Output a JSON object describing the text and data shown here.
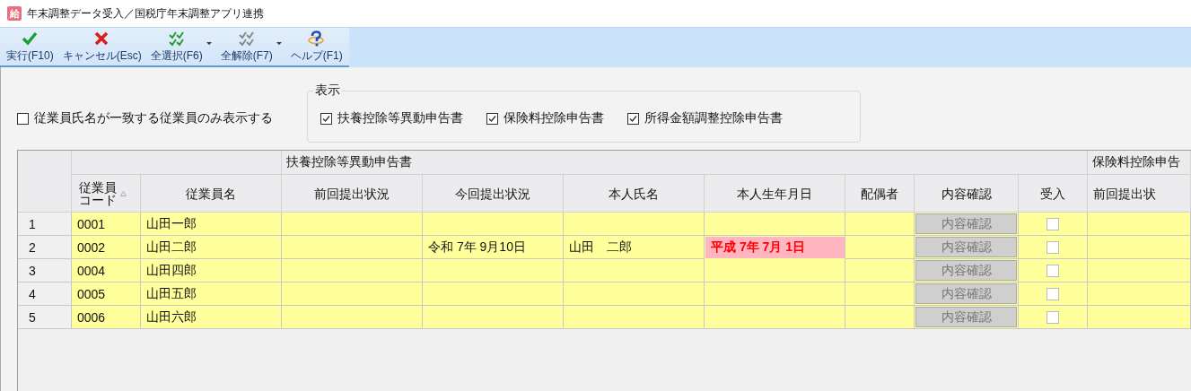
{
  "window": {
    "title": "年末調整データ受入／国税庁年末調整アプリ連携",
    "badge": "給"
  },
  "toolbar": [
    {
      "kind": "execute",
      "label": "実行(F10)",
      "dropdown": false
    },
    {
      "kind": "cancel",
      "label": "キャンセル(Esc)",
      "dropdown": false
    },
    {
      "kind": "select_all",
      "label": "全選択(F6)",
      "dropdown": true
    },
    {
      "kind": "deselect_all",
      "label": "全解除(F7)",
      "dropdown": true
    },
    {
      "kind": "help",
      "label": "ヘルプ(F1)",
      "dropdown": false
    }
  ],
  "filter": {
    "label": "従業員氏名が一致する従業員のみ表示する",
    "checked": false
  },
  "display": {
    "title": "表示",
    "options": [
      {
        "label": "扶養控除等異動申告書",
        "checked": true
      },
      {
        "label": "保険料控除申告書",
        "checked": true
      },
      {
        "label": "所得金額調整控除申告書",
        "checked": true
      }
    ]
  },
  "table": {
    "groups": [
      {
        "columns": [
          {
            "label": "従業員コード",
            "kind": "text",
            "sorted": true
          },
          {
            "label": "従業員名",
            "kind": "text",
            "sorted": false
          }
        ]
      },
      {
        "label": "扶養控除等異動申告書",
        "columns": [
          {
            "label": "前回提出状況",
            "kind": "text"
          },
          {
            "label": "今回提出状況",
            "kind": "text"
          },
          {
            "label": "本人氏名",
            "kind": "text"
          },
          {
            "label": "本人生年月日",
            "kind": "text"
          },
          {
            "label": "配偶者",
            "kind": "text"
          },
          {
            "label": "内容確認",
            "kind": "button"
          },
          {
            "label": "受入",
            "kind": "checkbox"
          }
        ]
      },
      {
        "label": "保険料控除申告",
        "columns": [
          {
            "label": "前回提出状",
            "kind": "text"
          }
        ]
      }
    ],
    "rows": [
      {
        "number": "1",
        "cells": [
          {
            "text": "0001"
          },
          {
            "text": "山田一郎"
          },
          {},
          {},
          {},
          {},
          {},
          {
            "label": "内容確認",
            "disabled": true
          },
          {
            "checked": false
          },
          {}
        ]
      },
      {
        "number": "2",
        "cells": [
          {
            "text": "0002"
          },
          {
            "text": "山田二郎"
          },
          {},
          {
            "text": "令和 7年 9月10日"
          },
          {
            "text": "山田　二郎"
          },
          {
            "text": "平成 7年 7月 1日",
            "highlighted": true
          },
          {},
          {
            "label": "内容確認",
            "disabled": true
          },
          {
            "checked": false
          },
          {}
        ]
      },
      {
        "number": "3",
        "cells": [
          {
            "text": "0004"
          },
          {
            "text": "山田四郎"
          },
          {},
          {},
          {},
          {},
          {},
          {
            "label": "内容確認",
            "disabled": true
          },
          {
            "checked": false
          },
          {}
        ]
      },
      {
        "number": "4",
        "cells": [
          {
            "text": "0005"
          },
          {
            "text": "山田五郎"
          },
          {},
          {},
          {},
          {},
          {},
          {
            "label": "内容確認",
            "disabled": true
          },
          {
            "checked": false
          },
          {}
        ]
      },
      {
        "number": "5",
        "cells": [
          {
            "text": "0006"
          },
          {
            "text": "山田六郎"
          },
          {},
          {},
          {},
          {},
          {},
          {
            "label": "内容確認",
            "disabled": true
          },
          {
            "checked": false
          },
          {}
        ]
      }
    ]
  }
}
